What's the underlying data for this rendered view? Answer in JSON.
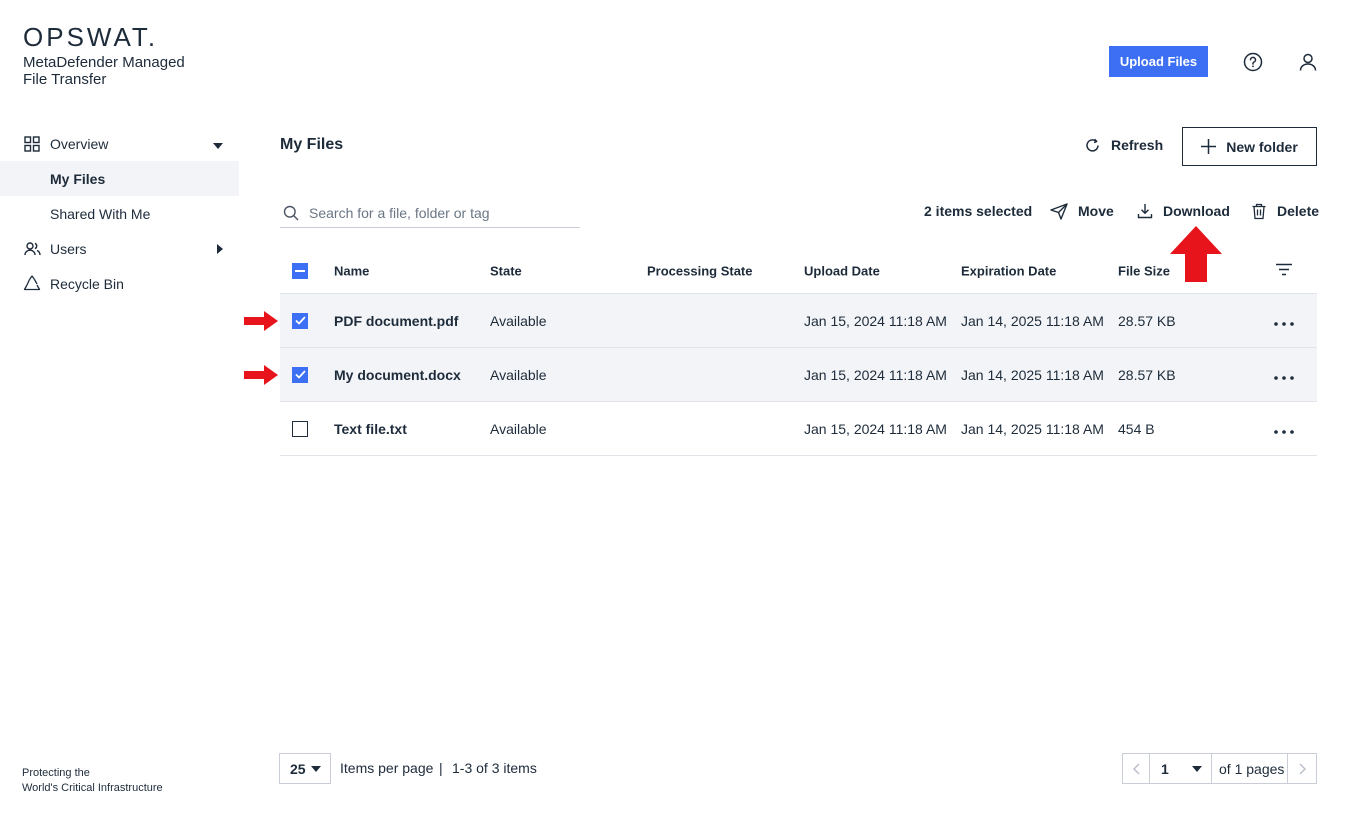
{
  "brand": {
    "logo_text": "OPSWAT.",
    "product_line1": "MetaDefender Managed",
    "product_line2": "File Transfer",
    "tagline_line1": "Protecting the",
    "tagline_line2": "World's Critical Infrastructure"
  },
  "header": {
    "upload_label": "Upload Files",
    "help_icon": "help-circle-icon",
    "user_icon": "user-icon"
  },
  "sidebar": {
    "items": [
      {
        "label": "Overview",
        "icon": "grid-icon"
      },
      {
        "label": "My Files"
      },
      {
        "label": "Shared With Me"
      },
      {
        "label": "Users",
        "icon": "users-icon"
      },
      {
        "label": "Recycle Bin",
        "icon": "recycle-icon"
      }
    ]
  },
  "main": {
    "title": "My Files",
    "refresh_label": "Refresh",
    "new_folder_label": "New folder",
    "search_placeholder": "Search for a file, folder or tag",
    "selected_count": "2 items selected",
    "actions": {
      "move": "Move",
      "download": "Download",
      "delete": "Delete"
    }
  },
  "table": {
    "columns": [
      "Name",
      "State",
      "Processing State",
      "Upload Date",
      "Expiration Date",
      "File Size"
    ],
    "rows": [
      {
        "checked": true,
        "name": "PDF document.pdf",
        "state": "Available",
        "processing": "",
        "upload": "Jan 15, 2024 11:18 AM",
        "expiration": "Jan 14, 2025 11:18 AM",
        "size": "28.57 KB"
      },
      {
        "checked": true,
        "name": "My document.docx",
        "state": "Available",
        "processing": "",
        "upload": "Jan 15, 2024 11:18 AM",
        "expiration": "Jan 14, 2025 11:18 AM",
        "size": "28.57 KB"
      },
      {
        "checked": false,
        "name": "Text file.txt",
        "state": "Available",
        "processing": "",
        "upload": "Jan 15, 2024 11:18 AM",
        "expiration": "Jan 14, 2025 11:18 AM",
        "size": "454 B"
      }
    ]
  },
  "pagination": {
    "page_size": "25",
    "items_per_page_label": "Items per page",
    "separator": "|",
    "range": "1-3 of 3 items",
    "current_page": "1",
    "of_pages": "of 1 pages"
  },
  "colors": {
    "accent": "#3d6ff5",
    "annotation": "#e8141c",
    "text": "#1d2b3a",
    "row_selected": "#f3f4f7"
  }
}
